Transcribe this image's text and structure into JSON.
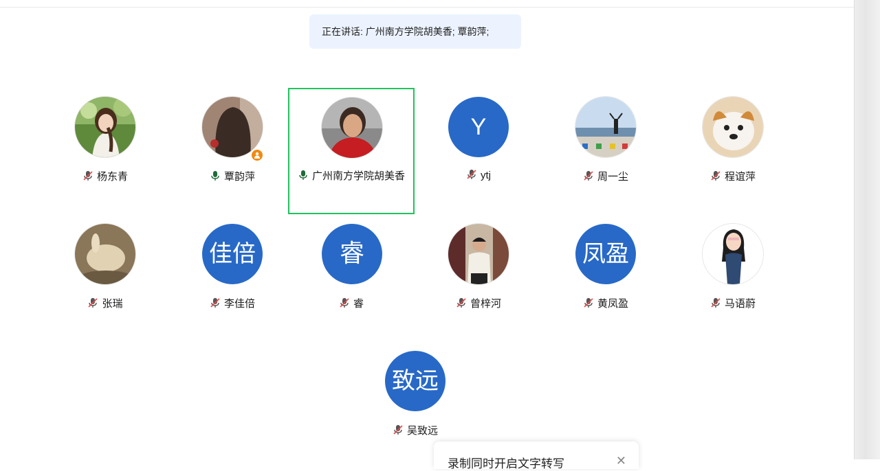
{
  "speaking_banner": "正在讲话: 广州南方学院胡美香; 覃韵萍;",
  "participants": [
    {
      "name": "杨东青",
      "mic": "muted",
      "avatar": "photo-girl"
    },
    {
      "name": "覃韵萍",
      "mic": "on",
      "avatar": "photo-hair",
      "badge": "host-badge-icon"
    },
    {
      "name": "广州南方学院胡美香",
      "mic": "on",
      "avatar": "photo-woman",
      "active": true
    },
    {
      "name": "ytj",
      "mic": "muted",
      "avatar_text": "Y"
    },
    {
      "name": "周一尘",
      "mic": "muted",
      "avatar": "photo-seaside"
    },
    {
      "name": "程谊萍",
      "mic": "muted",
      "avatar": "photo-dog"
    },
    {
      "name": "张瑞",
      "mic": "muted",
      "avatar": "photo-rabbit"
    },
    {
      "name": "李佳倍",
      "mic": "muted",
      "avatar_text": "佳倍"
    },
    {
      "name": "睿",
      "mic": "muted",
      "avatar_text": "睿"
    },
    {
      "name": "曾梓河",
      "mic": "muted",
      "avatar": "photo-man"
    },
    {
      "name": "黄凤盈",
      "mic": "muted",
      "avatar_text": "凤盈"
    },
    {
      "name": "马语蔚",
      "mic": "muted",
      "avatar": "cartoon-girl"
    },
    {
      "name": "吴致远",
      "mic": "muted",
      "avatar_text": "致远"
    }
  ],
  "toast": {
    "text": "录制同时开启文字转写",
    "close_icon": "close-icon"
  },
  "colors": {
    "avatar_blue": "#2869c7",
    "active_border": "#1ec35c",
    "banner_bg": "#ecf3ff",
    "host_badge": "#f08a12"
  }
}
